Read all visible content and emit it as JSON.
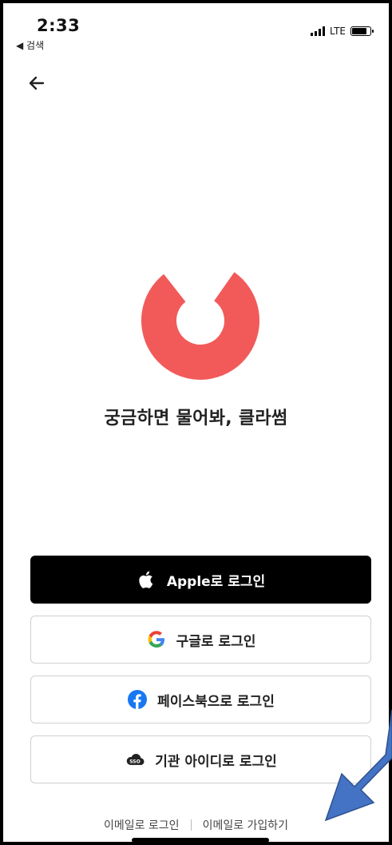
{
  "status_bar": {
    "time": "2:33",
    "back_app": "◀ 검색",
    "network": "LTE"
  },
  "nav": {
    "back_icon": "arrow-left-icon"
  },
  "brand": {
    "logo_icon": "speech-bubble-c-logo",
    "logo_color": "#F25A5A",
    "tagline": "궁금하면 물어봐, 클라썸"
  },
  "buttons": {
    "apple": {
      "label": "Apple로 로그인",
      "icon": "apple-icon"
    },
    "google": {
      "label": "구글로 로그인",
      "icon": "google-icon"
    },
    "facebook": {
      "label": "페이스북으로 로그인",
      "icon": "facebook-icon"
    },
    "sso": {
      "label": "기관 아이디로 로그인",
      "icon": "sso-cloud-icon"
    }
  },
  "links": {
    "email_login": "이메일로 로그인",
    "email_signup": "이메일로 가입하기"
  },
  "colors": {
    "apple_bg": "#000000",
    "facebook_blue": "#1877F2",
    "annotation_arrow": "#4472C4"
  }
}
